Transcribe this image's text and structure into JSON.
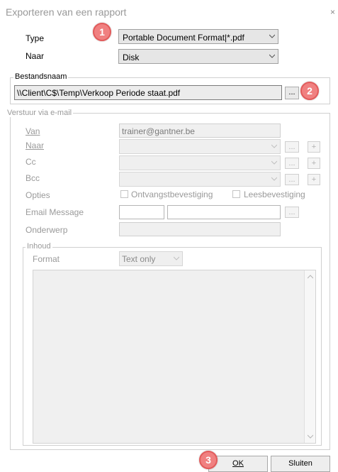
{
  "dialog": {
    "title": "Exporteren van een rapport",
    "close_glyph": "×"
  },
  "export": {
    "type_label": "Type",
    "type_value": "Portable Document Format|*.pdf",
    "naar_label": "Naar",
    "naar_value": "Disk"
  },
  "filename": {
    "group_label": "Bestandsnaam",
    "value": "\\\\Client\\C$\\Temp\\Verkoop Periode staat.pdf",
    "browse_label": "..."
  },
  "email": {
    "group_label": "Verstuur via e-mail",
    "van_label": "Van",
    "van_value": "trainer@gantner.be",
    "naar_label": "Naar",
    "cc_label": "Cc",
    "bcc_label": "Bcc",
    "dots_label": "...",
    "plus_label": "+",
    "opties_label": "Opties",
    "option1_label": "Ontvangstbevestiging",
    "option2_label": "Leesbevestiging",
    "message_label": "Email Message",
    "subject_label": "Onderwerp",
    "content": {
      "group_label": "Inhoud",
      "format_label": "Format",
      "format_value": "Text only"
    }
  },
  "footer": {
    "ok_label": "OK",
    "close_label": "Sluiten"
  },
  "annotations": {
    "badge1": "1",
    "badge2": "2",
    "badge3": "3",
    "badge_color": "#f08080"
  }
}
